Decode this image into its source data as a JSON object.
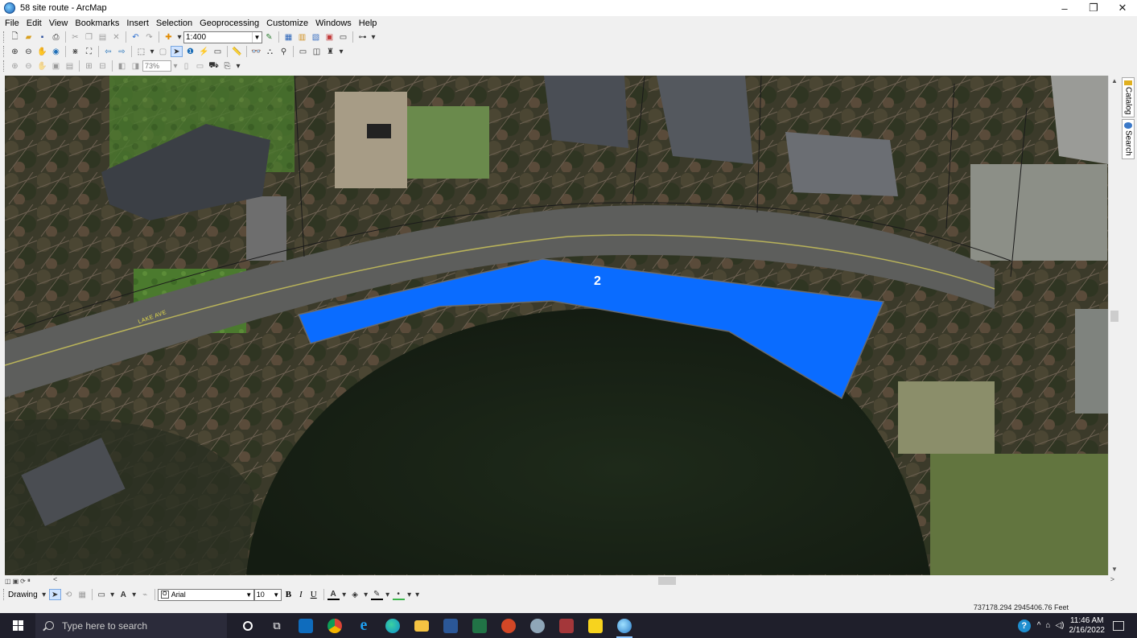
{
  "window": {
    "title": "58 site route - ArcMap",
    "minimize": "–",
    "restore": "❐",
    "close": "✕"
  },
  "menu": [
    "File",
    "Edit",
    "View",
    "Bookmarks",
    "Insert",
    "Selection",
    "Geoprocessing",
    "Customize",
    "Windows",
    "Help"
  ],
  "standard_toolbar": {
    "scale_value": "1:400"
  },
  "layout_toolbar": {
    "zoom_percent": "73%"
  },
  "map": {
    "polygon_label": "2",
    "road_label": "LAKE AVE",
    "polygon_color": "#0a6cff"
  },
  "side_tabs": {
    "catalog": "Catalog",
    "search": "Search"
  },
  "drawing_toolbar": {
    "label": "Drawing",
    "font_name": "Arial",
    "font_size": "10",
    "bold": "B",
    "italic": "I",
    "underline": "U"
  },
  "status": {
    "coordinates": "737178.294  2945406.76 Feet"
  },
  "taskbar": {
    "search_placeholder": "Type here to search",
    "time": "11:46 AM",
    "date": "2/16/2022",
    "apps": [
      {
        "name": "cortana",
        "color": "#ffffff"
      },
      {
        "name": "task-view",
        "color": "#ffffff"
      },
      {
        "name": "outlook",
        "color": "#0f6cbd"
      },
      {
        "name": "chrome",
        "color": "#f4b400"
      },
      {
        "name": "internet-explorer",
        "color": "#1ea0f2"
      },
      {
        "name": "edge",
        "color": "#0c8fcc"
      },
      {
        "name": "file-explorer",
        "color": "#f5c342"
      },
      {
        "name": "word",
        "color": "#2b5797"
      },
      {
        "name": "excel",
        "color": "#217346"
      },
      {
        "name": "powerpoint",
        "color": "#d24726"
      },
      {
        "name": "arcgis-pro",
        "color": "#5f9ea0"
      },
      {
        "name": "access",
        "color": "#a4373a"
      },
      {
        "name": "sticky-notes",
        "color": "#f7d31e"
      },
      {
        "name": "arcmap",
        "color": "#3c8fd6"
      }
    ]
  }
}
